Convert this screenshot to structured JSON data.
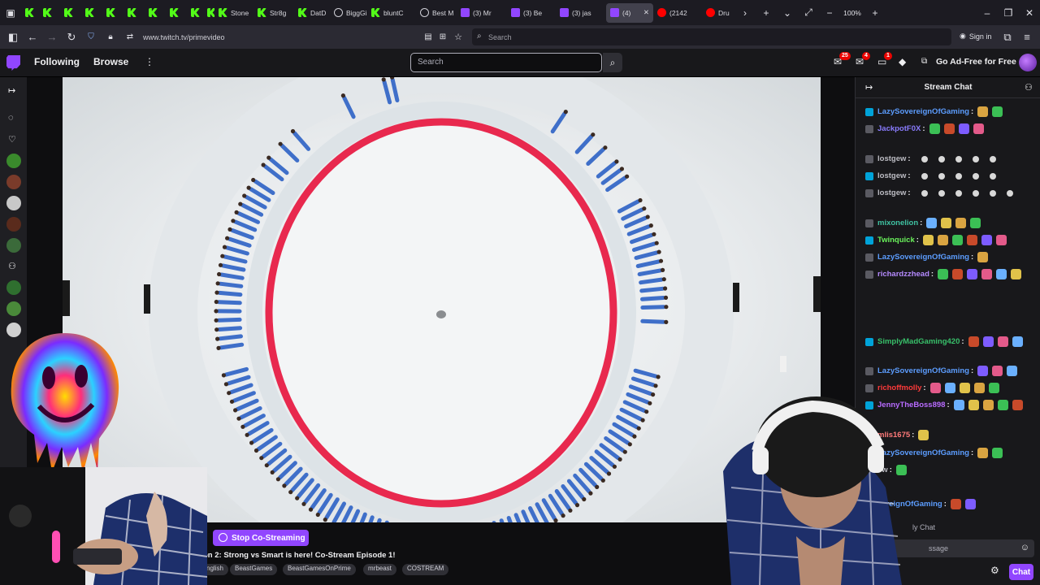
{
  "browser": {
    "tabs": [
      {
        "label": "",
        "icon": "kick"
      },
      {
        "label": "",
        "icon": "kick"
      },
      {
        "label": "",
        "icon": "kick"
      },
      {
        "label": "",
        "icon": "kick"
      },
      {
        "label": "",
        "icon": "kick"
      },
      {
        "label": "",
        "icon": "kick"
      },
      {
        "label": "",
        "icon": "kick"
      },
      {
        "label": "",
        "icon": "kick"
      },
      {
        "label": "",
        "icon": "kick"
      },
      {
        "label": "",
        "icon": "kick"
      },
      {
        "label": "Stone",
        "icon": "kick"
      },
      {
        "label": "Str8g",
        "icon": "kick"
      },
      {
        "label": "DatD",
        "icon": "kick"
      },
      {
        "label": "BiggGi",
        "icon": "gen"
      },
      {
        "label": "bluntC",
        "icon": "kick"
      },
      {
        "label": "Best M",
        "icon": "gen"
      },
      {
        "label": "(3) Mr",
        "icon": "tw"
      },
      {
        "label": "(3) Be",
        "icon": "tw"
      },
      {
        "label": "(3) jas",
        "icon": "tw"
      },
      {
        "label": "(4)",
        "icon": "tw",
        "active": true
      },
      {
        "label": "(2142",
        "icon": "yt"
      },
      {
        "label": "Dru",
        "icon": "yt"
      }
    ],
    "zoom": "100%",
    "url": "www.twitch.tv/primevideo",
    "search_placeholder": "Search",
    "signin": "Sign in"
  },
  "twitch": {
    "following": "Following",
    "browse": "Browse",
    "search_placeholder": "Search",
    "badges": {
      "inbox": "25",
      "notif": "4",
      "whispers": "1"
    },
    "ad_free": "Go Ad-Free for Free"
  },
  "stream": {
    "costream_button": "Stop Co-Streaming",
    "title": "on 2: Strong vs Smart is here! Co-Stream Episode 1!",
    "tags": [
      "nglish",
      "BeastGames",
      "BeastGamesOnPrime",
      "mrbeast",
      "COSTREAM"
    ]
  },
  "chat": {
    "title": "Stream Chat",
    "messages": [
      {
        "user": "LazySovereignOfGaming",
        "color": "#5c9dff",
        "emotes": 2
      },
      {
        "user": "JackpotF0X",
        "color": "#8a7cff",
        "emotes": 4
      },
      {
        "user": "lostgew",
        "color": "#bdbdc4",
        "emotes": 5
      },
      {
        "user": "lostgew",
        "color": "#bdbdc4",
        "emotes": 5
      },
      {
        "user": "lostgew",
        "color": "#bdbdc4",
        "emotes": 6
      },
      {
        "user": "mixonelion",
        "color": "#3fc2a2",
        "emotes": 4
      },
      {
        "user": "Twinquick",
        "color": "#6af35b",
        "emotes": 6
      },
      {
        "user": "LazySovereignOfGaming",
        "color": "#5c9dff",
        "emotes": 1
      },
      {
        "user": "richardzzhead",
        "color": "#b58aff",
        "emotes": 6
      },
      {
        "user": "SimplyMadGaming420",
        "color": "#38c06a",
        "emotes": 4
      },
      {
        "user": "LazySovereignOfGaming",
        "color": "#5c9dff",
        "emotes": 3
      },
      {
        "user": "richoffmolly",
        "color": "#ff3a3a",
        "emotes": 5
      },
      {
        "user": "JennyTheBoss898",
        "color": "#b86bff",
        "emotes": 5
      },
      {
        "user": "mlis1675",
        "color": "#ff7a7a",
        "emotes": 1
      },
      {
        "user": "LazySovereignOfGaming",
        "color": "#5c9dff",
        "emotes": 2
      },
      {
        "user": "ew",
        "color": "#bdbdc4",
        "emotes": 1
      },
      {
        "user": "vereignOfGaming",
        "color": "#5c9dff",
        "emotes": 2
      }
    ],
    "mode_label": "ly Chat",
    "input_placeholder": "ssage",
    "chat_button": "Chat"
  },
  "colors": {
    "twitch_purple": "#9146ff",
    "kick_green": "#53fc18",
    "ring_red": "#e8294e"
  }
}
